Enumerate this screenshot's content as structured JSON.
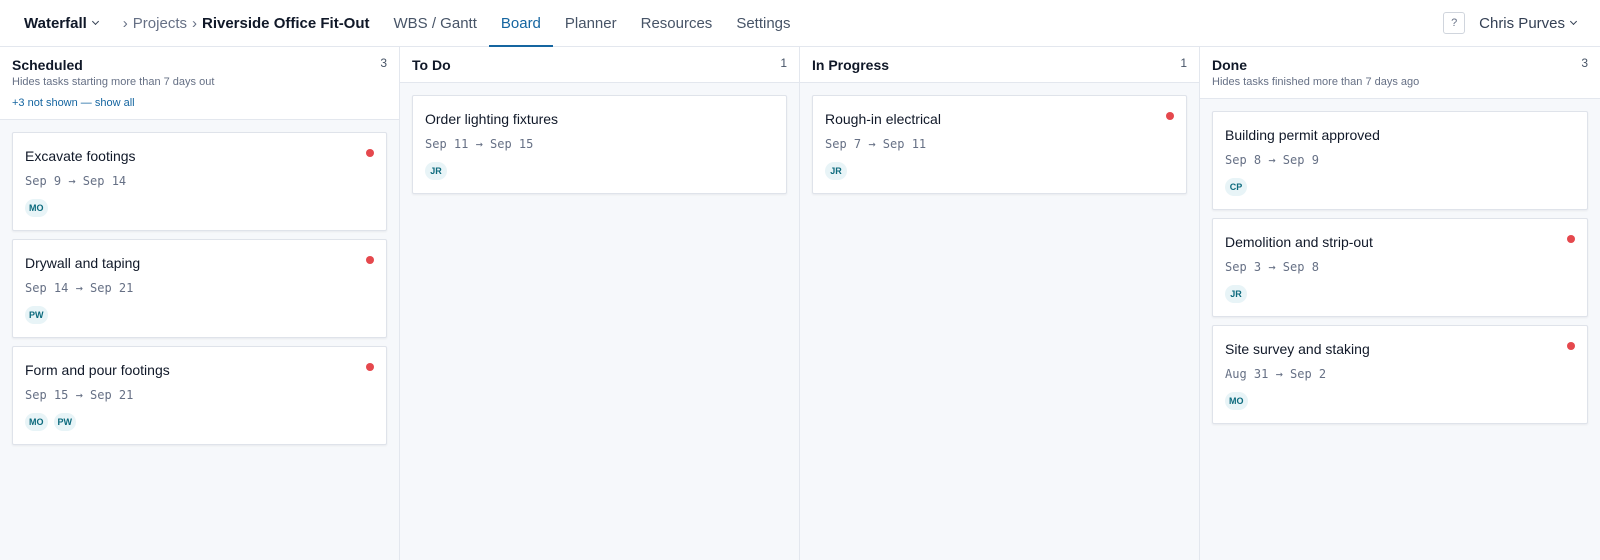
{
  "app": {
    "name": "Waterfall"
  },
  "breadcrumb": {
    "parent": "Projects",
    "current": "Riverside Office Fit-Out",
    "separator": "›"
  },
  "tabs": [
    {
      "label": "WBS / Gantt"
    },
    {
      "label": "Board"
    },
    {
      "label": "Planner"
    },
    {
      "label": "Resources"
    },
    {
      "label": "Settings"
    }
  ],
  "active_tab": "Board",
  "help": {
    "label": "?"
  },
  "user": {
    "name": "Chris Purves"
  },
  "colors": {
    "accent": "#1565a0",
    "overdue_dot": "#e5484d",
    "avatar_bg": "#e8f4f7",
    "avatar_text": "#0c6a7d"
  },
  "columns": [
    {
      "title": "Scheduled",
      "count": "3",
      "subtitle": "Hides tasks starting more than 7 days out",
      "show_link": "+3 not shown — show all",
      "cards": [
        {
          "title": "Excavate footings",
          "dates": "Sep 9 → Sep 14",
          "flag": true,
          "assignees": [
            "MO"
          ]
        },
        {
          "title": "Drywall and taping",
          "dates": "Sep 14 → Sep 21",
          "flag": true,
          "assignees": [
            "PW"
          ]
        },
        {
          "title": "Form and pour footings",
          "dates": "Sep 15 → Sep 21",
          "flag": true,
          "assignees": [
            "MO",
            "PW"
          ]
        }
      ]
    },
    {
      "title": "To Do",
      "count": "1",
      "cards": [
        {
          "title": "Order lighting fixtures",
          "dates": "Sep 11 → Sep 15",
          "flag": false,
          "assignees": [
            "JR"
          ]
        }
      ]
    },
    {
      "title": "In Progress",
      "count": "1",
      "cards": [
        {
          "title": "Rough-in electrical",
          "dates": "Sep 7 → Sep 11",
          "flag": true,
          "assignees": [
            "JR"
          ]
        }
      ]
    },
    {
      "title": "Done",
      "count": "3",
      "subtitle": "Hides tasks finished more than 7 days ago",
      "cards": [
        {
          "title": "Building permit approved",
          "dates": "Sep 8 → Sep 9",
          "flag": false,
          "assignees": [
            "CP"
          ]
        },
        {
          "title": "Demolition and strip-out",
          "dates": "Sep 3 → Sep 8",
          "flag": true,
          "assignees": [
            "JR"
          ]
        },
        {
          "title": "Site survey and staking",
          "dates": "Aug 31 → Sep 2",
          "flag": true,
          "assignees": [
            "MO"
          ]
        }
      ]
    }
  ]
}
